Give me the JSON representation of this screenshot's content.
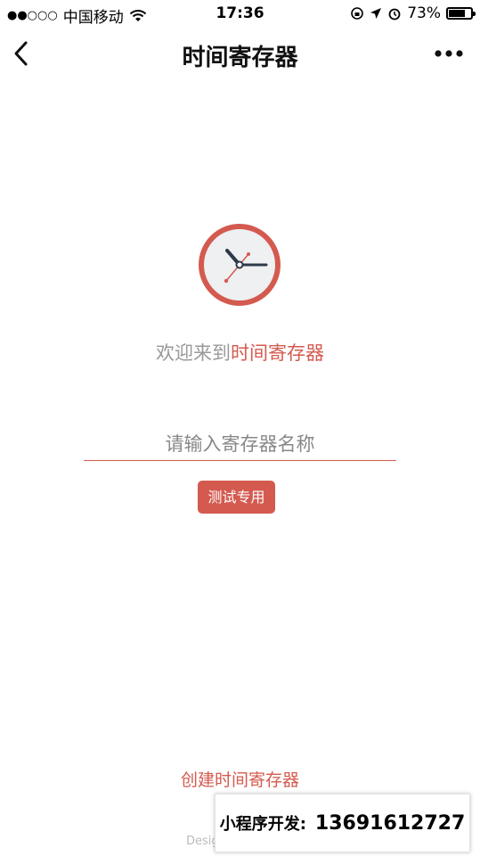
{
  "status_bar": {
    "signal": "●●○○○",
    "carrier": "中国移动",
    "time": "17:36",
    "battery_percent_text": "73%",
    "battery_level": 0.73
  },
  "nav": {
    "title": "时间寄存器"
  },
  "main": {
    "welcome_prefix": "欢迎来到",
    "welcome_app": "时间寄存器",
    "input_placeholder": "请输入寄存器名称",
    "input_value": "",
    "test_button": "测试专用",
    "create_link": "创建时间寄存器",
    "footer_text": "Desig"
  },
  "watermark": {
    "label": "小程序开发:",
    "phone": "13691612727"
  },
  "colors": {
    "accent": "#d45a4f",
    "clock_face": "#eef0f2",
    "clock_hands": "#2e3a4a"
  },
  "icons": {
    "back": "back-arrow-icon",
    "more": "more-dots-icon",
    "wifi": "wifi-icon",
    "clock": "clock-icon"
  }
}
